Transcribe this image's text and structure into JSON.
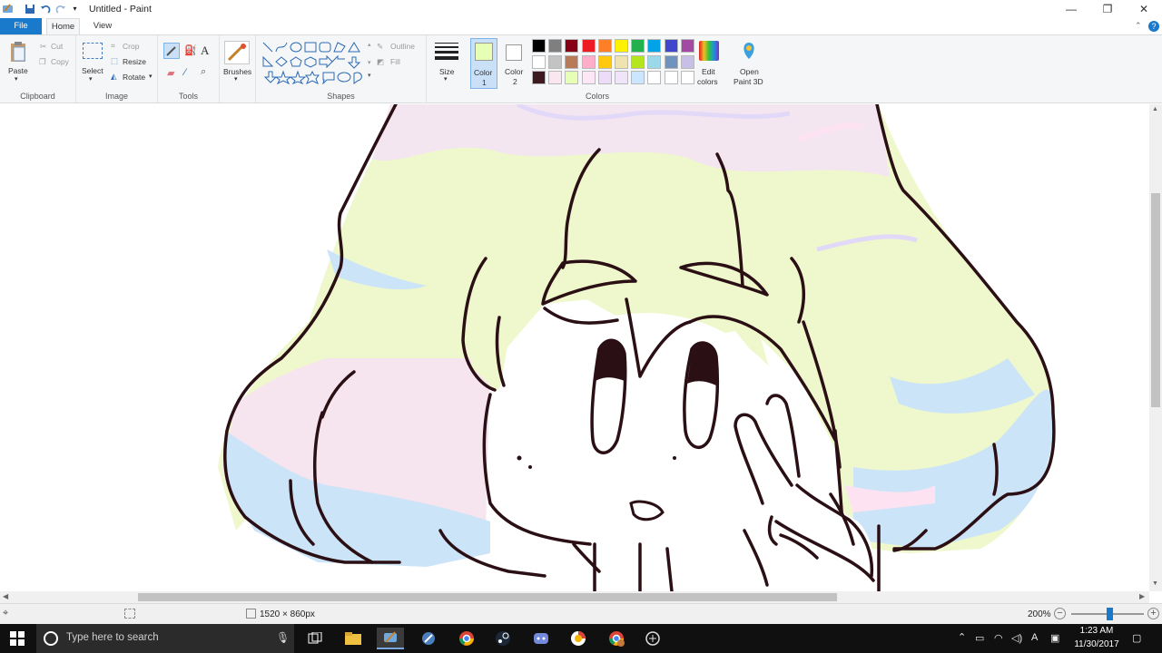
{
  "window": {
    "title": "Untitled - Paint",
    "minimize_glyph": "—",
    "restore_glyph": "❐",
    "close_glyph": "✕"
  },
  "tabs": {
    "file": "File",
    "home": "Home",
    "view": "View"
  },
  "ribbon": {
    "clipboard": {
      "label": "Clipboard",
      "paste": "Paste",
      "cut": "Cut",
      "copy": "Copy"
    },
    "image": {
      "label": "Image",
      "select": "Select",
      "crop": "Crop",
      "resize": "Resize",
      "rotate": "Rotate"
    },
    "tools": {
      "label": "Tools"
    },
    "brushes": {
      "label": "Brushes"
    },
    "shapes": {
      "label": "Shapes",
      "outline": "Outline",
      "fill": "Fill"
    },
    "size": {
      "label": "Size"
    },
    "colors": {
      "label": "Colors",
      "color1": "Color\n1",
      "color1_a": "Color",
      "color1_b": "1",
      "color2_a": "Color",
      "color2_b": "2",
      "edit_a": "Edit",
      "edit_b": "colors",
      "paint3d_a": "Open",
      "paint3d_b": "Paint 3D",
      "color1_value": "#e6ffb4",
      "color2_value": "#ffffff",
      "palette_row1": [
        "#000000",
        "#7f7f7f",
        "#880015",
        "#ed1c24",
        "#ff7f27",
        "#fff200",
        "#22b14c",
        "#00a2e8",
        "#3f48cc",
        "#a349a4"
      ],
      "palette_row2": [
        "#ffffff",
        "#c3c3c3",
        "#b97a57",
        "#ffaec9",
        "#ffc90e",
        "#efe4b0",
        "#b5e61d",
        "#99d9ea",
        "#7092be",
        "#c8bfe7"
      ],
      "palette_row3": [
        "#3d1a1f",
        "#f9e6ef",
        "#e6ffb4",
        "#fde6f6",
        "#ecdcf8",
        "#f0e4f8",
        "#cce6ff",
        "#ffffff",
        "#ffffff",
        "#ffffff"
      ]
    }
  },
  "status": {
    "dimensions": "1520 × 860px",
    "zoom": "200%"
  },
  "taskbar": {
    "search_placeholder": "Type here to search",
    "time": "1:23 AM",
    "date": "11/30/2017"
  },
  "drawing": {
    "hair_colors": [
      "#e6ffb4",
      "#f4e6f0",
      "#cce4f8",
      "#fde2f2",
      "#e2d8f8"
    ],
    "outline_color": "#2a0f14"
  }
}
